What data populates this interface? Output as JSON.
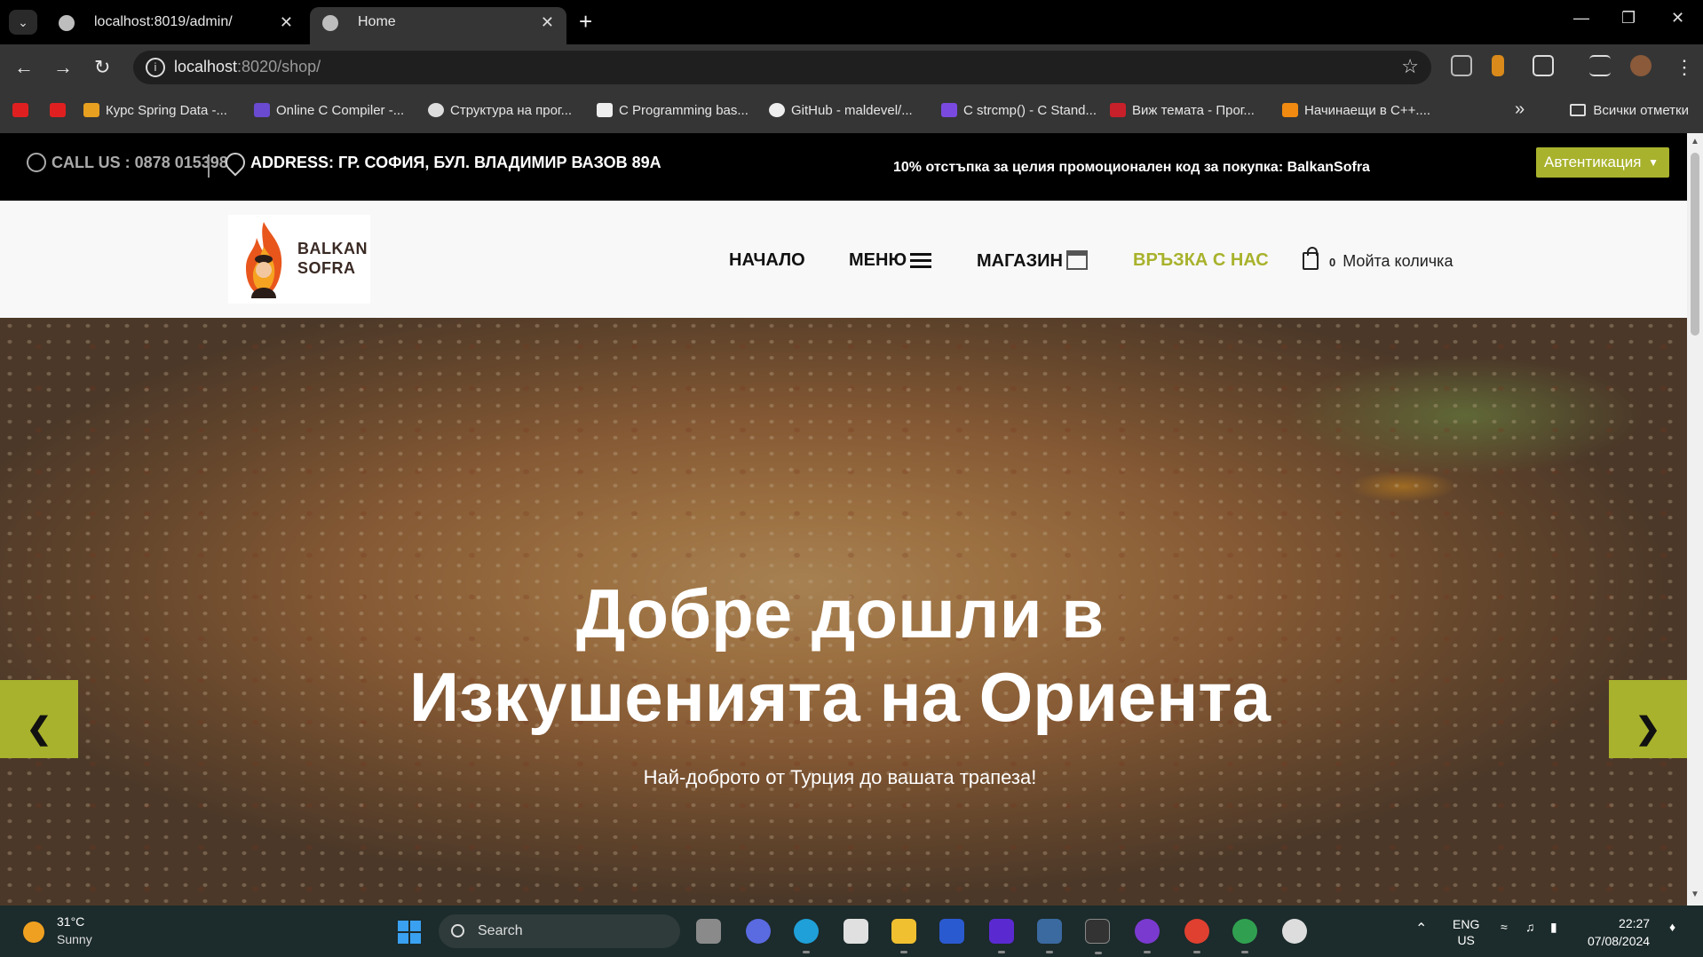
{
  "browser": {
    "tabs": [
      {
        "title": "localhost:8019/admin/",
        "active": false
      },
      {
        "title": "Home",
        "active": true
      }
    ],
    "url_host": "localhost",
    "url_rest": ":8020/shop/",
    "bookmarks": [
      "Курс Spring Data -...",
      "Online C Compiler -...",
      "Структура на прог...",
      "C Programming bas...",
      "GitHub - maldevel/...",
      "C strcmp() - C Stand...",
      "Виж темата - Прог...",
      "Начинаещи в C++...."
    ],
    "all_bookmarks": "Всички отметки"
  },
  "topbar": {
    "call": "CALL US : 0878 015398",
    "address": "ADDRESS: ГР. СОФИЯ, БУЛ. ВЛАДИМИР ВАЗОВ 89A",
    "promo": "10% отстъпка за целия промоционален код за покупка: BalkanSofra",
    "auth_button": "Автентикация"
  },
  "header": {
    "logo_line1": "BALKAN",
    "logo_line2": "SOFRA",
    "nav": {
      "home": "НАЧАЛО",
      "menu": "МЕНЮ",
      "shop": "МАГАЗИН",
      "contact": "ВРЪЗКА С НАС"
    },
    "cart_count": "0",
    "cart_label": "Мойта количка"
  },
  "hero": {
    "title_line1": "Добре дошли в",
    "title_line2": "Изкушенията на Ориента",
    "subtitle": "Най-доброто от Турция до вашата трапеза!"
  },
  "taskbar": {
    "temperature": "31°C",
    "condition": "Sunny",
    "search": "Search",
    "lang1": "ENG",
    "lang2": "US",
    "time": "22:27",
    "date": "07/08/2024"
  },
  "colors": {
    "accent": "#a8b22c",
    "topbar_bg": "#000000",
    "header_bg": "#f8f8f8"
  }
}
